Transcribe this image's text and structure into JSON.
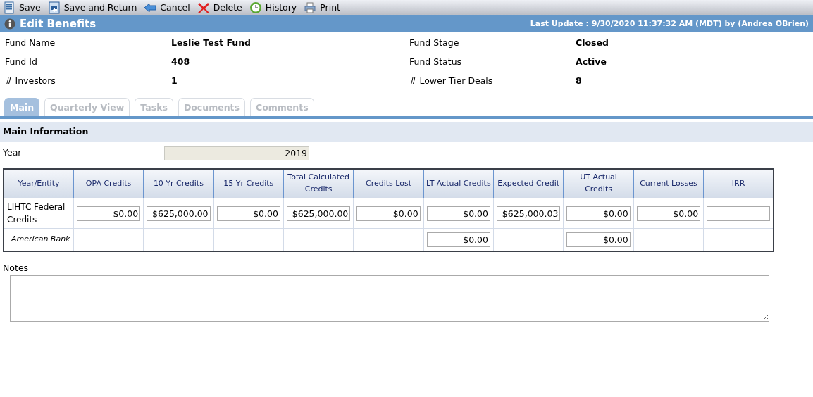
{
  "toolbar": [
    {
      "label": "Save"
    },
    {
      "label": "Save and Return"
    },
    {
      "label": "Cancel"
    },
    {
      "label": "Delete"
    },
    {
      "label": "History"
    },
    {
      "label": "Print"
    }
  ],
  "header": {
    "title": "Edit Benefits",
    "last_update": "Last Update : 9/30/2020 11:37:32 AM (MDT) by (Andrea OBrien)"
  },
  "fields": [
    {
      "label": "Fund Name",
      "value": "Leslie Test Fund"
    },
    {
      "label": "Fund Stage",
      "value": "Closed"
    },
    {
      "label": "Fund Id",
      "value": "408"
    },
    {
      "label": "Fund Status",
      "value": "Active"
    },
    {
      "label": "# Investors",
      "value": "1"
    },
    {
      "label": "# Lower Tier Deals",
      "value": "8"
    }
  ],
  "tabs": [
    {
      "label": "Main",
      "selected": true
    },
    {
      "label": "Quarterly View",
      "selected": false
    },
    {
      "label": "Tasks",
      "selected": false
    },
    {
      "label": "Documents",
      "selected": false
    },
    {
      "label": "Comments",
      "selected": false
    }
  ],
  "section": {
    "title": "Main Information",
    "year_label": "Year",
    "year_value": "2019"
  },
  "table": {
    "columns": [
      "Year/Entity",
      "OPA Credits",
      "10 Yr Credits",
      "15 Yr Credits",
      "Total Calculated Credits",
      "Credits Lost",
      "LT Actual Credits",
      "Expected Credit",
      "UT Actual Credits",
      "Current Losses",
      "IRR"
    ],
    "rows": [
      {
        "kind": "credit",
        "cells": [
          "LIHTC Federal Credits",
          "$0.00",
          "$625,000.00",
          "$0.00",
          "$625,000.00",
          "$0.00",
          "$0.00",
          "$625,000.03",
          "$0.00",
          "$0.00",
          ""
        ]
      },
      {
        "kind": "entity",
        "cells": [
          "American Bank",
          null,
          null,
          null,
          null,
          null,
          "$0.00",
          null,
          "$0.00",
          null,
          null
        ]
      }
    ]
  },
  "notes": {
    "label": "Notes"
  }
}
